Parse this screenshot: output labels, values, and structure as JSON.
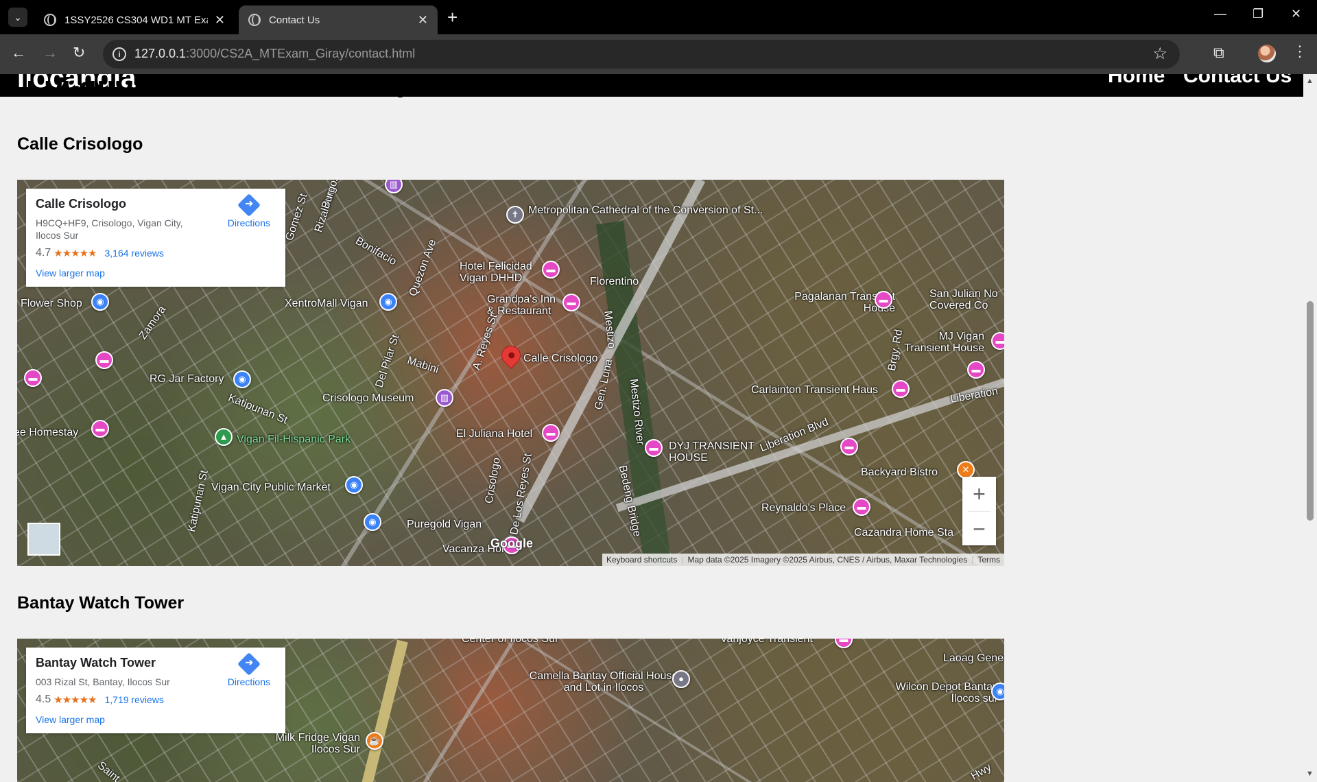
{
  "browser": {
    "tabs": [
      {
        "title": "1SSY2526 CS304 WD1 MT Exam"
      },
      {
        "title": "Contact Us"
      }
    ],
    "new_tab": "+",
    "url_host": "127.0.0.1",
    "url_rest": ":3000/CS2A_MTExam_Giray/contact.html"
  },
  "site": {
    "logo": "Ilocandia",
    "nav": [
      "Home",
      "Contact Us"
    ],
    "heading": "Locations of the Tourist Spots"
  },
  "sections": [
    {
      "title": "Calle Crisologo",
      "card": {
        "name": "Calle Crisologo",
        "address": "H9CQ+HF9, Crisologo, Vigan City, Ilocos Sur",
        "rating": "4.7",
        "stars": "★★★★★",
        "reviews": "3,164 reviews",
        "larger_map": "View larger map",
        "directions": "Directions"
      },
      "labels": {
        "cathedral": "Metropolitan Cathedral of the Conversion of St...",
        "felicidad": "Hotel Felicidad Vigan DHHD",
        "florentino": "Florentino",
        "grandpa": "Grandpa's Inn & Restaurant",
        "flower": "Flower Shop",
        "xentro": "XentroMall Vigan",
        "quezon": "Quezon Ave",
        "bonifacio": "Bonifacio",
        "pagalanan": "Pagalanan Transient House",
        "sanjulian": "San Julian No Covered Co",
        "mjvigan": "MJ Vigan Transient House",
        "calle": "Calle Crisologo",
        "mabini": "Mabini",
        "areyes": "A. Reyes St",
        "rgjar": "RG Jar Factory",
        "museum": "Crisologo Museum",
        "katipunan": "Katipunan St",
        "carlainton": "Carlainton Transient Haus",
        "liberation": "Liberation",
        "liberation_blvd": "Liberation Blvd",
        "homestay": "ee Homestay",
        "hispanic": "Vigan Fil-Hispanic Park",
        "juliana": "El Juliana Hotel",
        "dyj": "DYJ TRANSIENT HOUSE",
        "backyard": "Backyard Bistro",
        "market": "Vigan City Public Market",
        "puregold": "Puregold Vigan",
        "reynaldo": "Reynaldo's Place",
        "cazandra": "Cazandra Home Sta",
        "vacanza": "Vacanza Home",
        "mestizo": "Mestizo River",
        "zamora": "Zamora",
        "gomez": "Gomez St",
        "rizal": "Rizal Ave",
        "burgos": "Burgos St",
        "delpilar": "Del Pilar St",
        "bedeng": "Bedeng Bridge",
        "brgy": "Brgy. Rd",
        "genluna": "Gen. Luna",
        "mestizo2": "Mestizo",
        "crisologo_st": "Crisologo",
        "delosreyes": "De Los Reyes St",
        "katipunan2": "Katipunan St"
      },
      "attribution": {
        "shortcuts": "Keyboard shortcuts",
        "data": "Map data ©2025 Imagery ©2025 Airbus, CNES / Airbus, Maxar Technologies",
        "terms": "Terms"
      },
      "google": "Google",
      "zoom_in": "+",
      "zoom_out": "−"
    },
    {
      "title": "Bantay Watch Tower",
      "card": {
        "name": "Bantay Watch Tower",
        "address": "003 Rizal St, Bantay, Ilocos Sur",
        "rating": "4.5",
        "stars": "★★★★★",
        "reviews": "1,719 reviews",
        "larger_map": "View larger map",
        "directions": "Directions"
      },
      "labels": {
        "center": "Center of Ilocos Sur",
        "vanjoyce": "Vanjoyce Transient",
        "laoag": "Laoag Gene",
        "camella": "Camella Bantay Official House and Lot in Ilocos",
        "wilcon": "Wilcon Depot Bantay Ilocos sur",
        "milkfridge": "Milk Fridge Vigan Ilocos Sur",
        "hwy": "Hwy",
        "saint": "Saint"
      }
    }
  ],
  "colors": {
    "accent": "#1a73e8",
    "star": "#e7711b",
    "hotel_pin": "#e548c5",
    "shop_pin": "#3b82f6",
    "main_pin": "#e53935"
  }
}
